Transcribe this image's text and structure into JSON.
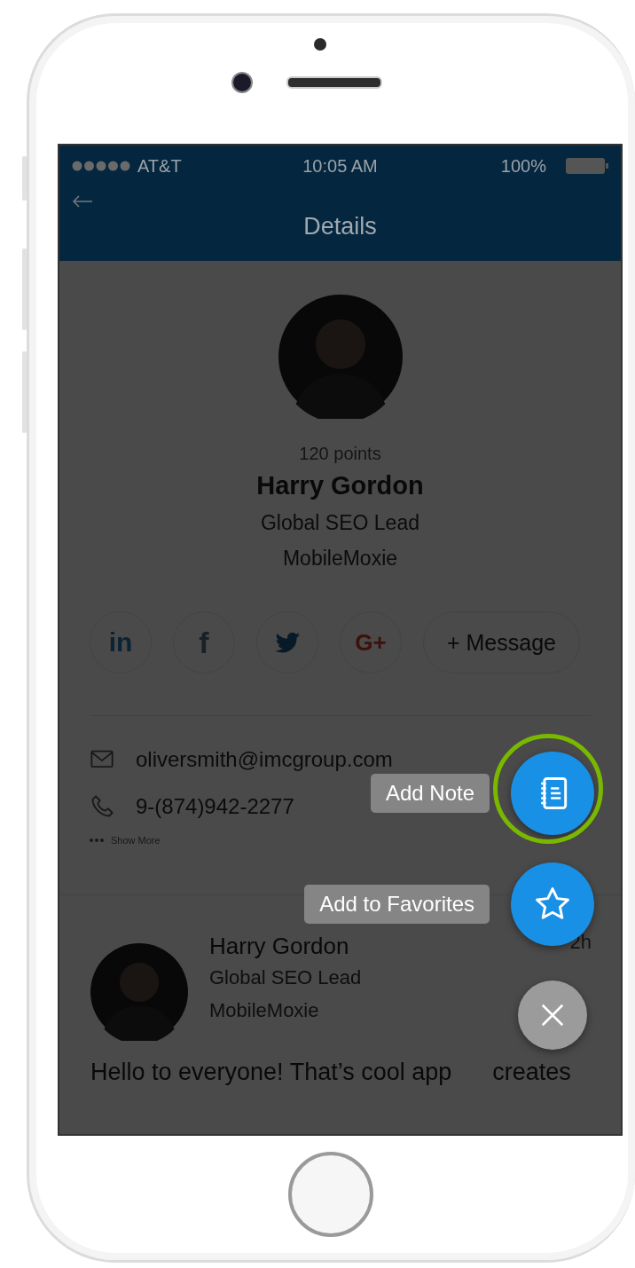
{
  "status_bar": {
    "carrier": "AT&T",
    "time": "10:05 AM",
    "battery": "100%"
  },
  "nav_bar": {
    "title": "Details"
  },
  "profile": {
    "points": "120 points",
    "name": "Harry Gordon",
    "job_title": "Global SEO Lead",
    "company": "MobileMoxie"
  },
  "social_buttons": [
    {
      "kind": "linkedin",
      "label": "in"
    },
    {
      "kind": "facebook",
      "label": "f"
    },
    {
      "kind": "twitter"
    },
    {
      "kind": "google-plus",
      "label": "G+"
    }
  ],
  "message_button": "+ Message",
  "contacts": [
    {
      "kind": "email",
      "text": "oliversmith@imcgroup.com"
    },
    {
      "kind": "phone",
      "text": "9-(874)942-2277"
    }
  ],
  "show_more": "Show More",
  "post": {
    "author": "Harry Gordon",
    "job_title": "Global SEO Lead",
    "company": "MobileMoxie",
    "time": "2h",
    "text": "Hello to everyone! That’s cool app",
    "text_end": "creates"
  },
  "fab_actions": [
    {
      "label": "Add Note",
      "kind": "note",
      "highlighted": true
    },
    {
      "label": "Add to Favorites",
      "kind": "star",
      "highlighted": false
    }
  ]
}
